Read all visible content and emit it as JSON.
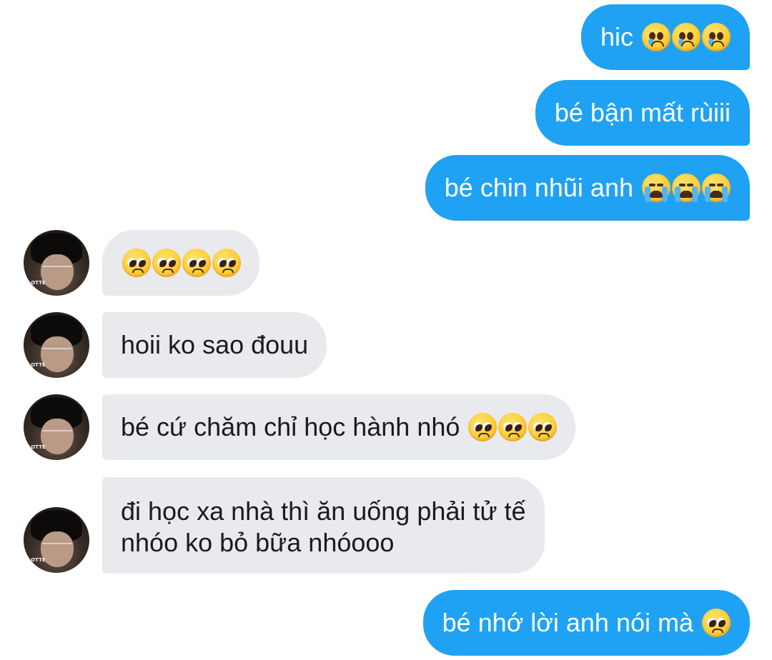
{
  "messages": [
    {
      "id": "m1",
      "side": "outgoing",
      "text": "hic",
      "emojis": [
        "crying-face",
        "crying-face",
        "crying-face"
      ]
    },
    {
      "id": "m2",
      "side": "outgoing",
      "text": "bé bận mất rùiii",
      "emojis": []
    },
    {
      "id": "m3",
      "side": "outgoing",
      "text": "bé chin nhũi anh",
      "emojis": [
        "loudly-crying-face",
        "loudly-crying-face",
        "loudly-crying-face"
      ]
    },
    {
      "id": "m4",
      "side": "incoming",
      "text": "",
      "emojis": [
        "pleading-face",
        "pleading-face",
        "pleading-face",
        "pleading-face"
      ]
    },
    {
      "id": "m5",
      "side": "incoming",
      "text": "hoii ko sao đouu",
      "emojis": []
    },
    {
      "id": "m6",
      "side": "incoming",
      "text": "bé cứ chăm chỉ học hành nhó",
      "emojis": [
        "pleading-face",
        "pleading-face",
        "pleading-face"
      ]
    },
    {
      "id": "m7",
      "side": "incoming",
      "lines": [
        "đi học xa nhà thì ăn uống phải tử tế",
        "nhóo ko bỏ bữa nhóooo"
      ],
      "emojis": []
    },
    {
      "id": "m8",
      "side": "outgoing",
      "text": "bé nhớ lời anh nói mà",
      "emojis": [
        "pleading-face"
      ]
    }
  ],
  "avatar": {
    "shirt_text": "LOTTE"
  },
  "colors": {
    "outgoing_bubble": "#1fa2f3",
    "incoming_bubble": "#e9eaee",
    "outgoing_text": "#ffffff",
    "incoming_text": "#1b1b1b",
    "background": "#ffffff"
  }
}
